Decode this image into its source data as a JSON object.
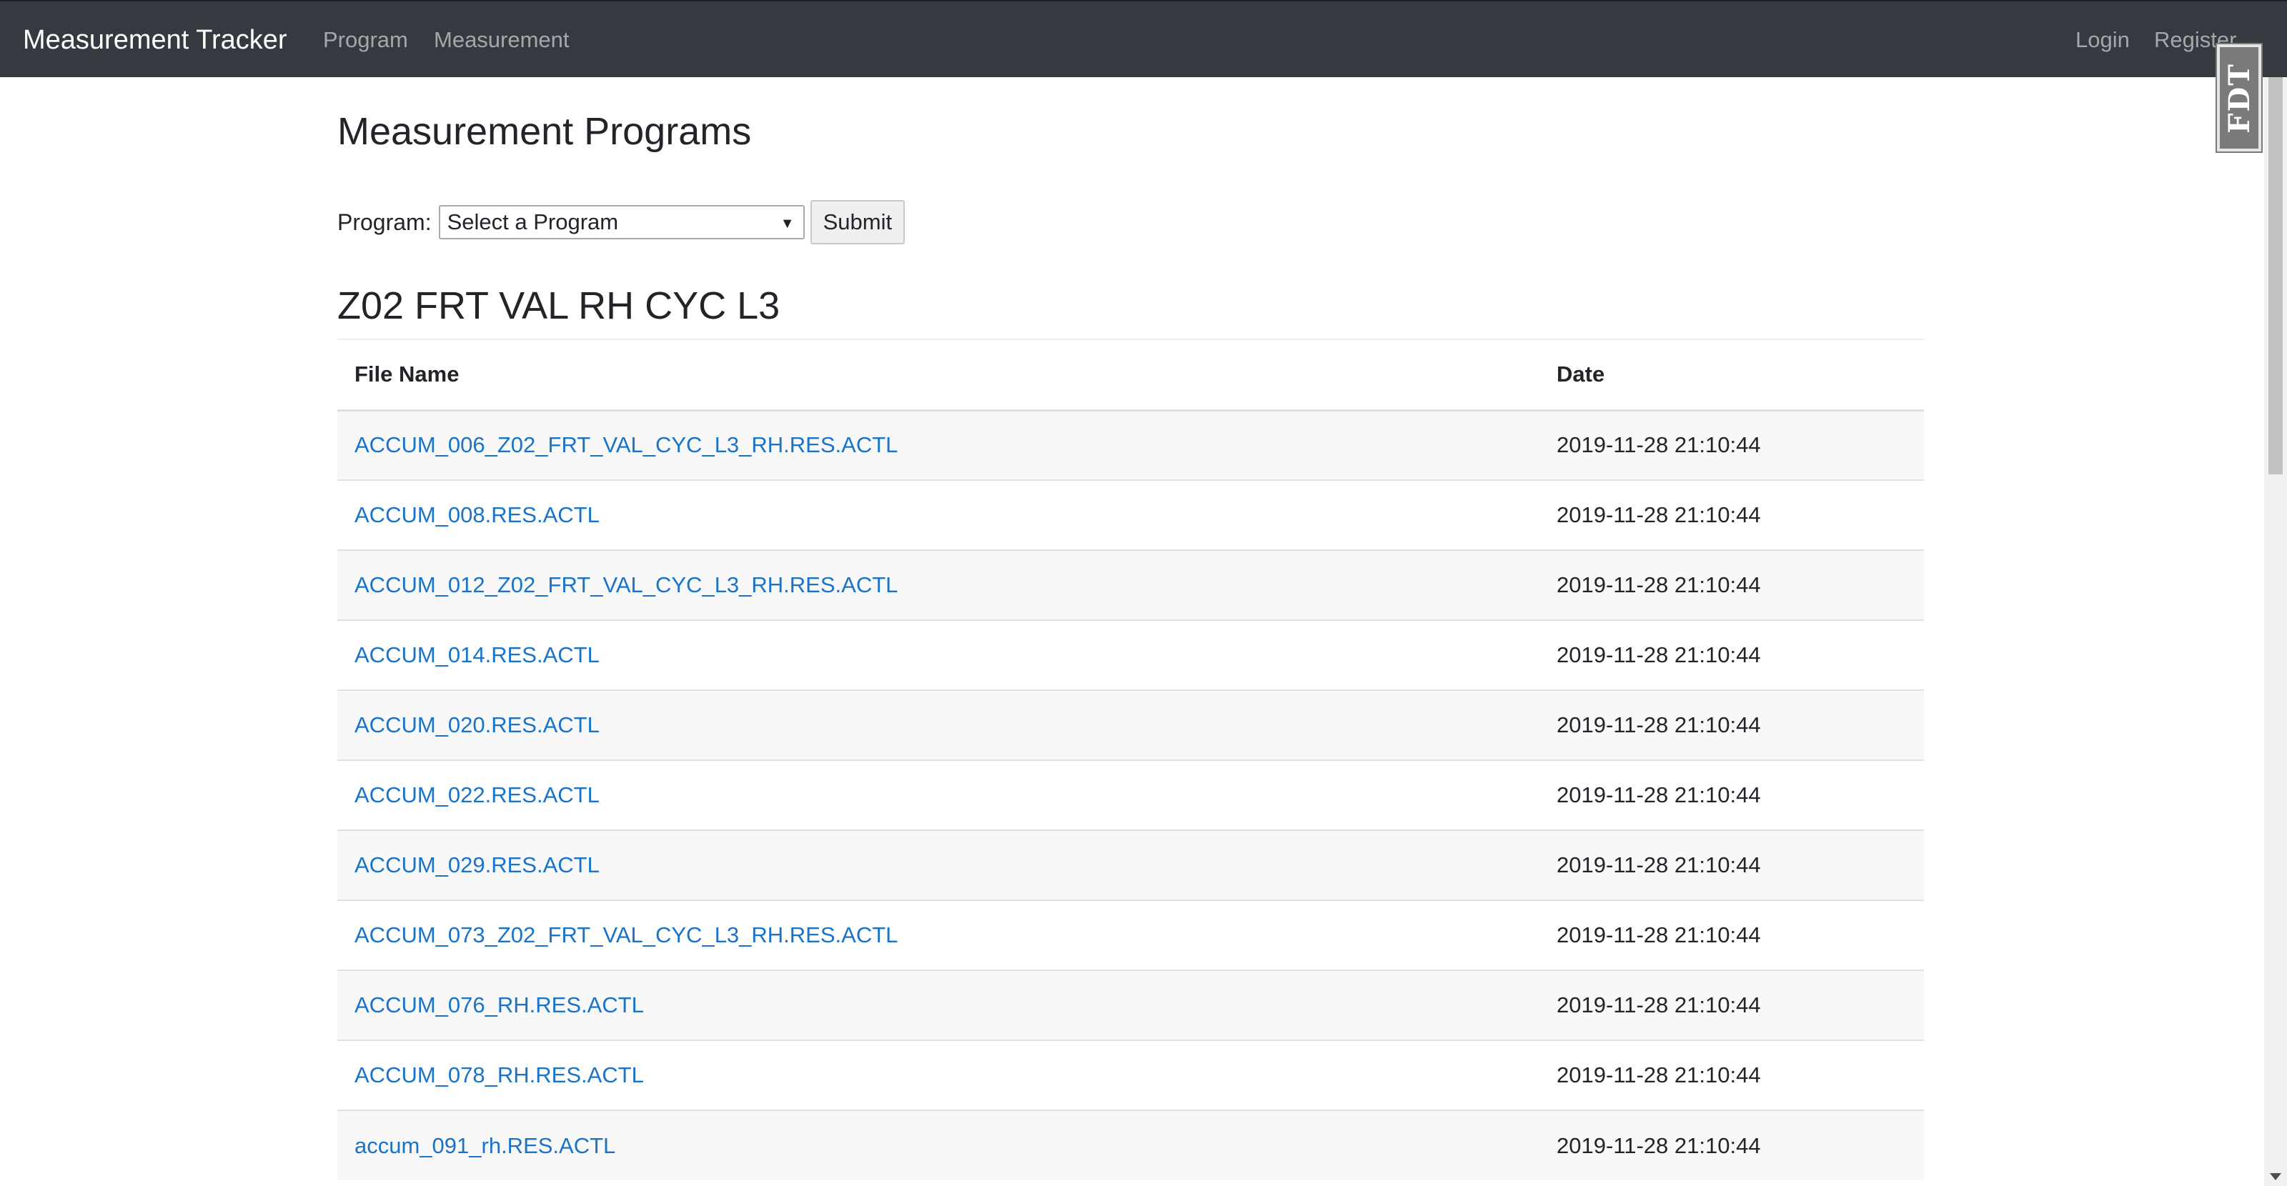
{
  "navbar": {
    "brand": "Measurement Tracker",
    "links": [
      "Program",
      "Measurement"
    ],
    "right_links": [
      "Login",
      "Register"
    ],
    "bg_color": "#343a40"
  },
  "badge": {
    "text": "FDT"
  },
  "page": {
    "title": "Measurement Programs"
  },
  "form": {
    "label": "Program:",
    "select_value": "Select a Program",
    "submit_label": "Submit"
  },
  "section": {
    "title": "Z02 FRT VAL RH CYC L3"
  },
  "table": {
    "headers": [
      "File Name",
      "Date"
    ],
    "link_color": "#1a73c7",
    "rows": [
      {
        "file": "ACCUM_006_Z02_FRT_VAL_CYC_L3_RH.RES.ACTL",
        "date": "2019-11-28 21:10:44"
      },
      {
        "file": "ACCUM_008.RES.ACTL",
        "date": "2019-11-28 21:10:44"
      },
      {
        "file": "ACCUM_012_Z02_FRT_VAL_CYC_L3_RH.RES.ACTL",
        "date": "2019-11-28 21:10:44"
      },
      {
        "file": "ACCUM_014.RES.ACTL",
        "date": "2019-11-28 21:10:44"
      },
      {
        "file": "ACCUM_020.RES.ACTL",
        "date": "2019-11-28 21:10:44"
      },
      {
        "file": "ACCUM_022.RES.ACTL",
        "date": "2019-11-28 21:10:44"
      },
      {
        "file": "ACCUM_029.RES.ACTL",
        "date": "2019-11-28 21:10:44"
      },
      {
        "file": "ACCUM_073_Z02_FRT_VAL_CYC_L3_RH.RES.ACTL",
        "date": "2019-11-28 21:10:44"
      },
      {
        "file": "ACCUM_076_RH.RES.ACTL",
        "date": "2019-11-28 21:10:44"
      },
      {
        "file": "ACCUM_078_RH.RES.ACTL",
        "date": "2019-11-28 21:10:44"
      },
      {
        "file": "accum_091_rh.RES.ACTL",
        "date": "2019-11-28 21:10:44"
      }
    ]
  }
}
